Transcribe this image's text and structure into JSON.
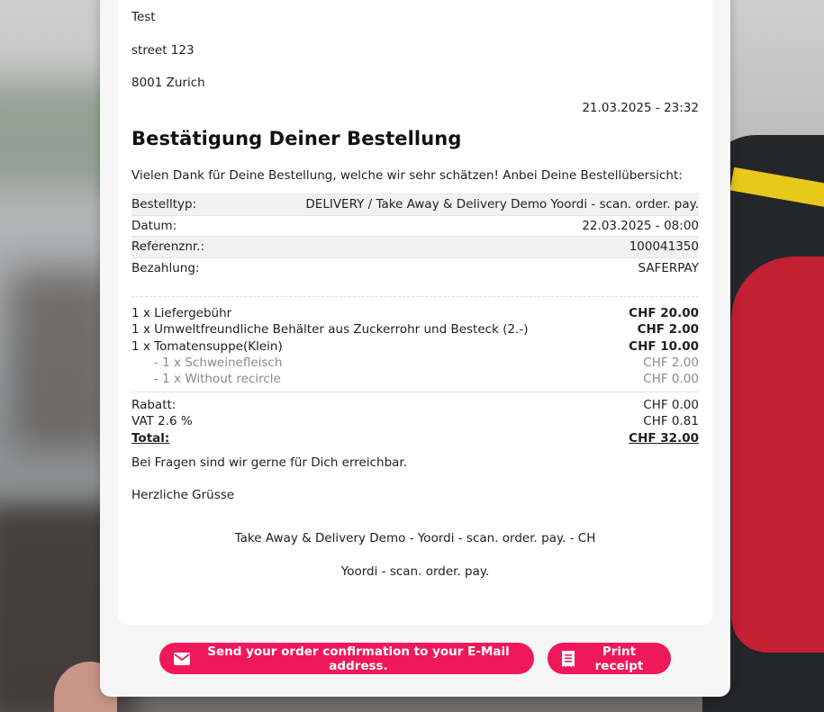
{
  "address": {
    "name": "Test",
    "street": "street 123",
    "city": "8001 Zurich"
  },
  "order_datetime": "21.03.2025 - 23:32",
  "title": "Bestätigung Deiner Bestellung",
  "intro": "Vielen Dank für Deine Bestellung, welche wir sehr schätzen! Anbei Deine Bestellübersicht:",
  "info_rows": [
    {
      "label": "Bestelltyp:",
      "value": "DELIVERY / Take Away & Delivery Demo Yoordi - scan. order. pay."
    },
    {
      "label": "Datum:",
      "value": "22.03.2025 - 08:00"
    },
    {
      "label": "Referenznr.:",
      "value": "100041350"
    },
    {
      "label": "Bezahlung:",
      "value": "SAFERPAY"
    }
  ],
  "items": [
    {
      "name": "1 x Liefergebühr",
      "price": "CHF 20.00"
    },
    {
      "name": "1 x Umweltfreundliche Behälter aus Zuckerrohr und Besteck (2.-)",
      "price": "CHF 2.00"
    },
    {
      "name": "1 x Tomatensuppe(Klein)",
      "price": "CHF 10.00"
    }
  ],
  "sub_items": [
    {
      "name": "- 1 x Schweinefleisch",
      "price": "CHF 2.00"
    },
    {
      "name": "- 1 x Without recircle",
      "price": "CHF 0.00"
    }
  ],
  "totals": {
    "discount_label": "Rabatt:",
    "discount": "CHF 0.00",
    "vat_label": "VAT 2.6 %",
    "vat": "CHF 0.81",
    "total_label": "Total:",
    "total": "CHF 32.00"
  },
  "questions": "Bei Fragen sind wir gerne für Dich erreichbar.",
  "greeting": "Herzliche Grüsse",
  "footer_line1": "Take Away & Delivery Demo - Yoordi - scan. order. pay. - CH",
  "footer_line2": "Yoordi - scan. order. pay.",
  "buttons": {
    "email_label": "Send your order confirmation to your E-Mail address.",
    "email_icon": "envelope-icon",
    "print_label": "Print receipt",
    "print_icon": "receipt-icon"
  },
  "colors": {
    "accent": "#f0185a"
  }
}
